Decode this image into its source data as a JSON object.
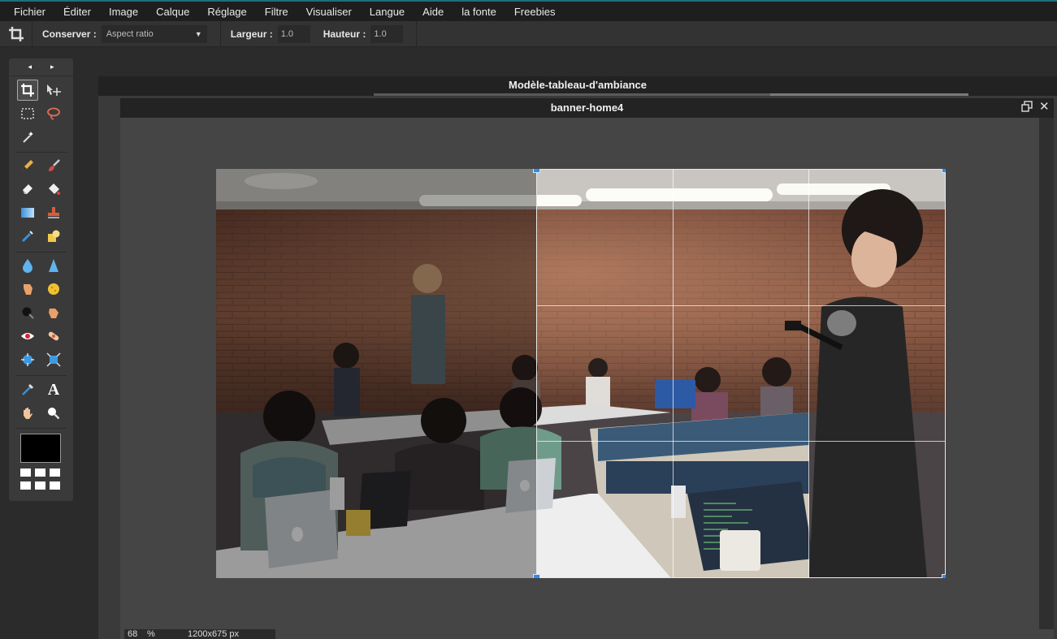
{
  "menu": [
    "Fichier",
    "Éditer",
    "Image",
    "Calque",
    "Réglage",
    "Filtre",
    "Visualiser",
    "Langue",
    "Aide",
    "la fonte",
    "Freebies"
  ],
  "options": {
    "keep_label": "Conserver :",
    "keep_value": "Aspect ratio",
    "width_label": "Largeur :",
    "width_value": "1.0",
    "height_label": "Hauteur :",
    "height_value": "1.0"
  },
  "toolbox": {
    "prev": "◂",
    "next": "▸",
    "text_tool_glyph": "A",
    "foreground_color": "#000000"
  },
  "documents": {
    "background_title": "Modèle-tableau-d'ambiance",
    "active_title": "banner-home4"
  },
  "status": {
    "zoom": "68",
    "zoom_unit": "%",
    "size": "1200x675 px"
  },
  "colors": {
    "accent": "#2f8de4",
    "menubar": "#1e1e1e"
  }
}
